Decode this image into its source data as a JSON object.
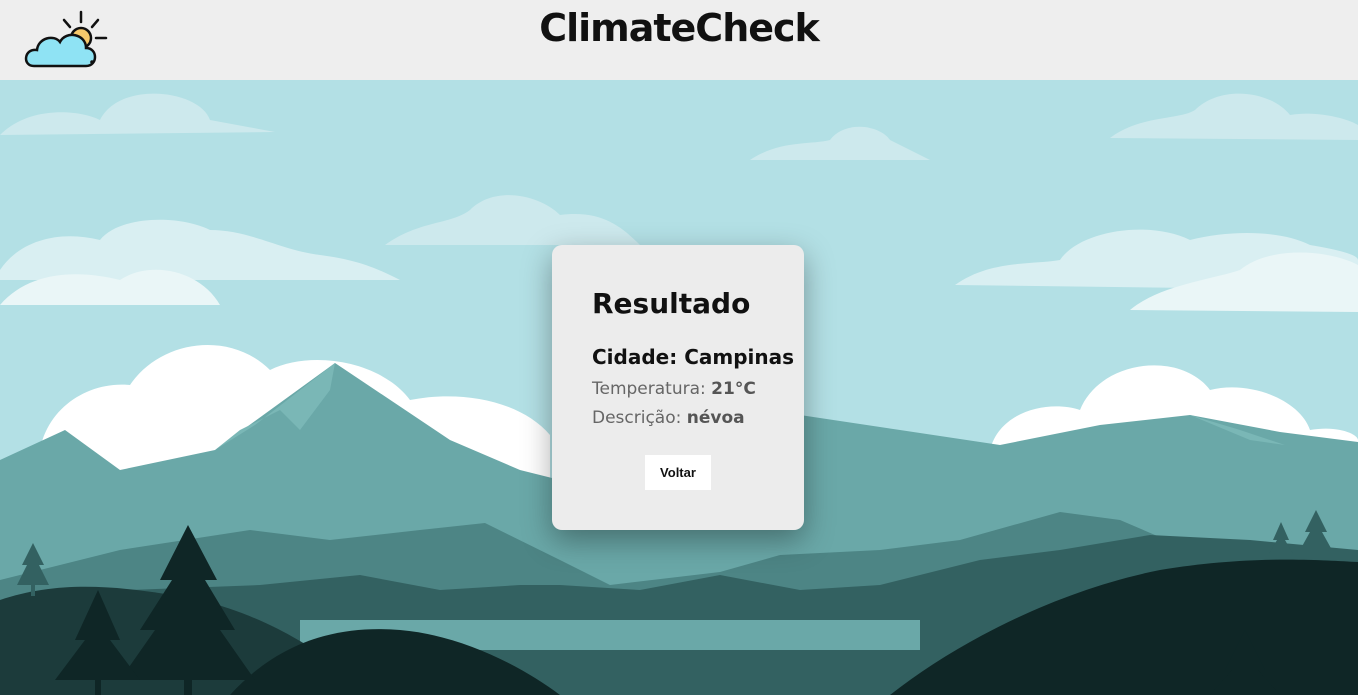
{
  "header": {
    "title": "ClimateCheck",
    "logo_icon": "cloud-sun-icon"
  },
  "result": {
    "title": "Resultado",
    "city_label": "Cidade:",
    "city_value": "Campinas",
    "temperature_label": "Temperatura:",
    "temperature_value": "21°C",
    "description_label": "Descrição:",
    "description_value": "névoa",
    "back_button": "Voltar"
  },
  "colors": {
    "header_bg": "#eeeeee",
    "sky": "#b3e0e5",
    "card_bg": "#ececec",
    "mountain_light": "#6aa8a8",
    "mountain_dark": "#336161",
    "forest": "#0f2626"
  }
}
